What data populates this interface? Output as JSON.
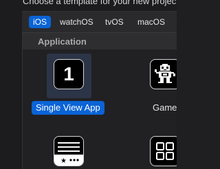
{
  "dialog": {
    "heading": "Choose a template for your new project:"
  },
  "platform_tabs": [
    {
      "label": "iOS",
      "selected": true
    },
    {
      "label": "watchOS",
      "selected": false
    },
    {
      "label": "tvOS",
      "selected": false
    },
    {
      "label": "macOS",
      "selected": false
    }
  ],
  "section": {
    "label": "Application"
  },
  "templates": [
    {
      "label": "Single View App",
      "icon": "single-view-app-icon",
      "glyph": "1",
      "selected": true
    },
    {
      "label": "Game",
      "icon": "game-icon",
      "selected": false
    },
    {
      "label": "",
      "icon": "tabbed-app-icon",
      "selected": false
    },
    {
      "label": "",
      "icon": "grid-app-icon",
      "selected": false
    }
  ],
  "colors": {
    "accent": "#0a64d6",
    "background": "#1c1c1e"
  }
}
